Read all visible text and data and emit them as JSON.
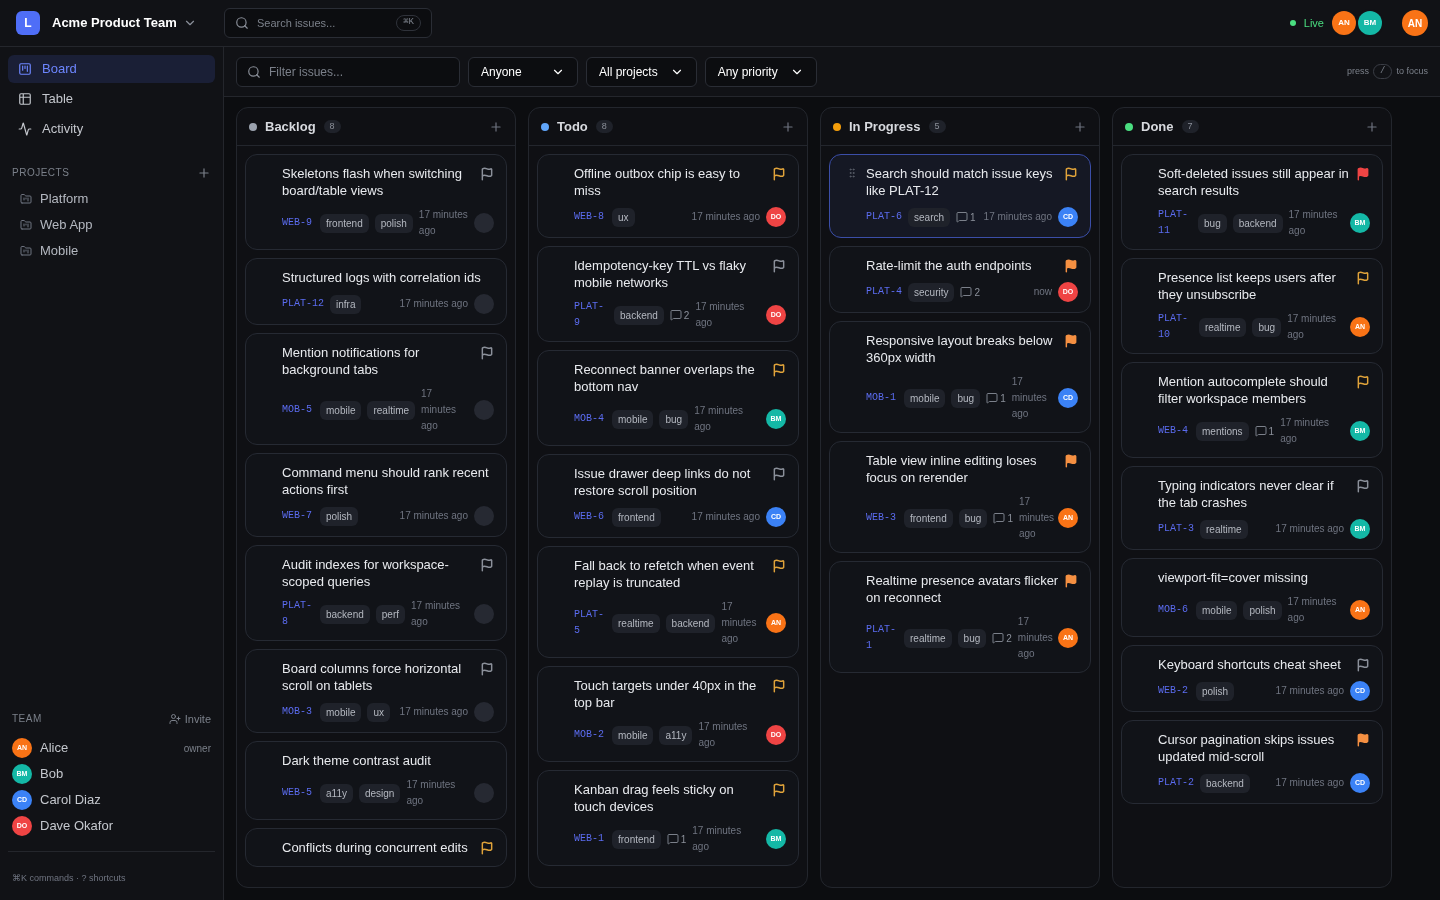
{
  "workspace": {
    "logo": "L",
    "name": "Acme Product Team"
  },
  "search": {
    "placeholder": "Search issues...",
    "shortcut": "⌘K"
  },
  "presence": {
    "status": "Live",
    "live": true,
    "viewers": [
      {
        "initials": "AN",
        "color": "#f97316"
      },
      {
        "initials": "BM",
        "color": "#14b8a6"
      }
    ]
  },
  "user": {
    "initials": "AN",
    "color": "#f97316"
  },
  "nav": [
    {
      "label": "Board",
      "kind": "board",
      "selected": true
    },
    {
      "label": "Table",
      "kind": "table",
      "selected": false
    },
    {
      "label": "Activity",
      "kind": "activity",
      "selected": false
    }
  ],
  "projects": {
    "title": "PROJECTS",
    "items": [
      "Platform",
      "Web App",
      "Mobile"
    ]
  },
  "team": {
    "title": "TEAM",
    "invite": "Invite",
    "members": [
      {
        "name": "Alice",
        "initials": "AN",
        "color": "#f97316",
        "role": "owner"
      },
      {
        "name": "Bob",
        "initials": "BM",
        "color": "#14b8a6"
      },
      {
        "name": "Carol Diaz",
        "initials": "CD",
        "color": "#3b82f6"
      },
      {
        "name": "Dave Okafor",
        "initials": "DO",
        "color": "#ef4444"
      }
    ]
  },
  "footer": "⌘K commands · ? shortcuts",
  "filters": {
    "placeholder": "Filter issues...",
    "selects": [
      "Anyone",
      "All projects",
      "Any priority"
    ],
    "hint_before": "press",
    "hint_key": "/",
    "hint_after": "to focus"
  },
  "columns": [
    {
      "name": "Backlog",
      "color": "#9ca3af",
      "count": "8",
      "cards": [
        {
          "title": "Skeletons flash when switching board/table views",
          "key": "WEB-9",
          "tags": [
            "frontend",
            "polish"
          ],
          "time": "17 minutes ago",
          "flag": {
            "color": "#8b909a",
            "filled": false
          },
          "selected": false
        },
        {
          "title": "Structured logs with correlation ids",
          "key": "PLAT-12",
          "tags": [
            "infra"
          ],
          "time": "17 minutes ago",
          "selected": false
        },
        {
          "title": "Mention notifications for background tabs",
          "key": "MOB-5",
          "tags": [
            "mobile",
            "realtime"
          ],
          "time": "17 minutes ago",
          "flag": {
            "color": "#8b909a",
            "filled": false
          },
          "selected": false
        },
        {
          "title": "Command menu should rank recent actions first",
          "key": "WEB-7",
          "tags": [
            "polish"
          ],
          "time": "17 minutes ago",
          "selected": false
        },
        {
          "title": "Audit indexes for workspace-scoped queries",
          "key": "PLAT-8",
          "tags": [
            "backend",
            "perf"
          ],
          "time": "17 minutes ago",
          "flag": {
            "color": "#8b909a",
            "filled": false
          },
          "selected": false
        },
        {
          "title": "Board columns force horizontal scroll on tablets",
          "key": "MOB-3",
          "tags": [
            "mobile",
            "ux"
          ],
          "time": "17 minutes ago",
          "flag": {
            "color": "#8b909a",
            "filled": false
          },
          "selected": false
        },
        {
          "title": "Dark theme contrast audit",
          "key": "WEB-5",
          "tags": [
            "a11y",
            "design"
          ],
          "time": "17 minutes ago",
          "selected": false
        },
        {
          "title": "Conflicts during concurrent edits",
          "flag": {
            "color": "#e0a33a",
            "filled": false
          },
          "selected": false
        }
      ]
    },
    {
      "name": "Todo",
      "color": "#60a5fa",
      "count": "8",
      "cards": [
        {
          "title": "Offline outbox chip is easy to miss",
          "key": "WEB-8",
          "tags": [
            "ux"
          ],
          "time": "17 minutes ago",
          "flag": {
            "color": "#e0a33a",
            "filled": false
          },
          "assignee": {
            "initials": "DO",
            "color": "#ef4444"
          },
          "selected": false
        },
        {
          "title": "Idempotency-key TTL vs flaky mobile networks",
          "key": "PLAT-9",
          "tags": [
            "backend"
          ],
          "comments": "2",
          "time": "17 minutes ago",
          "flag": {
            "color": "#8b909a",
            "filled": false
          },
          "assignee": {
            "initials": "DO",
            "color": "#ef4444"
          },
          "selected": false
        },
        {
          "title": "Reconnect banner overlaps the bottom nav",
          "key": "MOB-4",
          "tags": [
            "mobile",
            "bug"
          ],
          "time": "17 minutes ago",
          "flag": {
            "color": "#e0a33a",
            "filled": false
          },
          "assignee": {
            "initials": "BM",
            "color": "#14b8a6"
          },
          "selected": false
        },
        {
          "title": "Issue drawer deep links do not restore scroll position",
          "key": "WEB-6",
          "tags": [
            "frontend"
          ],
          "time": "17 minutes ago",
          "flag": {
            "color": "#8b909a",
            "filled": false
          },
          "assignee": {
            "initials": "CD",
            "color": "#3b82f6"
          },
          "selected": false
        },
        {
          "title": "Fall back to refetch when event replay is truncated",
          "key": "PLAT-5",
          "tags": [
            "realtime",
            "backend"
          ],
          "time": "17 minutes ago",
          "flag": {
            "color": "#e0a33a",
            "filled": false
          },
          "assignee": {
            "initials": "AN",
            "color": "#f97316"
          },
          "selected": false
        },
        {
          "title": "Touch targets under 40px in the top bar",
          "key": "MOB-2",
          "tags": [
            "mobile",
            "a11y"
          ],
          "time": "17 minutes ago",
          "flag": {
            "color": "#e0a33a",
            "filled": false
          },
          "assignee": {
            "initials": "DO",
            "color": "#ef4444"
          },
          "selected": false
        },
        {
          "title": "Kanban drag feels sticky on touch devices",
          "key": "WEB-1",
          "tags": [
            "frontend"
          ],
          "comments": "1",
          "time": "17 minutes ago",
          "flag": {
            "color": "#e0a33a",
            "filled": false
          },
          "assignee": {
            "initials": "BM",
            "color": "#14b8a6"
          },
          "selected": false
        }
      ]
    },
    {
      "name": "In Progress",
      "color": "#f59e0b",
      "count": "5",
      "cards": [
        {
          "title": "Search should match issue keys like PLAT-12",
          "key": "PLAT-6",
          "tags": [
            "search"
          ],
          "comments": "1",
          "time": "17 minutes ago",
          "flag": {
            "color": "#e0a33a",
            "filled": false
          },
          "assignee": {
            "initials": "CD",
            "color": "#3b82f6"
          },
          "selected": true
        },
        {
          "title": "Rate-limit the auth endpoints",
          "key": "PLAT-4",
          "tags": [
            "security"
          ],
          "comments": "2",
          "time": "now",
          "flag": {
            "color": "#f59042",
            "filled": true
          },
          "assignee": {
            "initials": "DO",
            "color": "#ef4444"
          },
          "selected": false
        },
        {
          "title": "Responsive layout breaks below 360px width",
          "key": "MOB-1",
          "tags": [
            "mobile",
            "bug"
          ],
          "comments": "1",
          "time": "17 minutes ago",
          "flag": {
            "color": "#f59042",
            "filled": true
          },
          "assignee": {
            "initials": "CD",
            "color": "#3b82f6"
          },
          "selected": false
        },
        {
          "title": "Table view inline editing loses focus on rerender",
          "key": "WEB-3",
          "tags": [
            "frontend",
            "bug"
          ],
          "comments": "1",
          "time": "17 minutes ago",
          "flag": {
            "color": "#f59042",
            "filled": true
          },
          "assignee": {
            "initials": "AN",
            "color": "#f97316"
          },
          "selected": false
        },
        {
          "title": "Realtime presence avatars flicker on reconnect",
          "key": "PLAT-1",
          "tags": [
            "realtime",
            "bug"
          ],
          "comments": "2",
          "time": "17 minutes ago",
          "flag": {
            "color": "#f59042",
            "filled": true
          },
          "assignee": {
            "initials": "AN",
            "color": "#f97316"
          },
          "selected": false
        }
      ]
    },
    {
      "name": "Done",
      "color": "#4ade80",
      "count": "7",
      "cards": [
        {
          "title": "Soft-deleted issues still appear in search results",
          "key": "PLAT-11",
          "tags": [
            "bug",
            "backend"
          ],
          "time": "17 minutes ago",
          "flag": {
            "color": "#ef4444",
            "filled": true
          },
          "assignee": {
            "initials": "BM",
            "color": "#14b8a6"
          },
          "selected": false
        },
        {
          "title": "Presence list keeps users after they unsubscribe",
          "key": "PLAT-10",
          "tags": [
            "realtime",
            "bug"
          ],
          "time": "17 minutes ago",
          "flag": {
            "color": "#e0a33a",
            "filled": false
          },
          "assignee": {
            "initials": "AN",
            "color": "#f97316"
          },
          "selected": false
        },
        {
          "title": "Mention autocomplete should filter workspace members",
          "key": "WEB-4",
          "tags": [
            "mentions"
          ],
          "comments": "1",
          "time": "17 minutes ago",
          "flag": {
            "color": "#e0a33a",
            "filled": false
          },
          "assignee": {
            "initials": "BM",
            "color": "#14b8a6"
          },
          "selected": false
        },
        {
          "title": "Typing indicators never clear if the tab crashes",
          "key": "PLAT-3",
          "tags": [
            "realtime"
          ],
          "time": "17 minutes ago",
          "flag": {
            "color": "#8b909a",
            "filled": false
          },
          "assignee": {
            "initials": "BM",
            "color": "#14b8a6"
          },
          "selected": false
        },
        {
          "title": "viewport-fit=cover missing",
          "key": "MOB-6",
          "tags": [
            "mobile",
            "polish"
          ],
          "time": "17 minutes ago",
          "assignee": {
            "initials": "AN",
            "color": "#f97316"
          },
          "selected": false
        },
        {
          "title": "Keyboard shortcuts cheat sheet",
          "key": "WEB-2",
          "tags": [
            "polish"
          ],
          "time": "17 minutes ago",
          "flag": {
            "color": "#8b909a",
            "filled": false
          },
          "assignee": {
            "initials": "CD",
            "color": "#3b82f6"
          },
          "selected": false
        },
        {
          "title": "Cursor pagination skips issues updated mid-scroll",
          "key": "PLAT-2",
          "tags": [
            "backend"
          ],
          "time": "17 minutes ago",
          "flag": {
            "color": "#f59042",
            "filled": true
          },
          "assignee": {
            "initials": "CD",
            "color": "#3b82f6"
          },
          "selected": false
        }
      ]
    }
  ]
}
